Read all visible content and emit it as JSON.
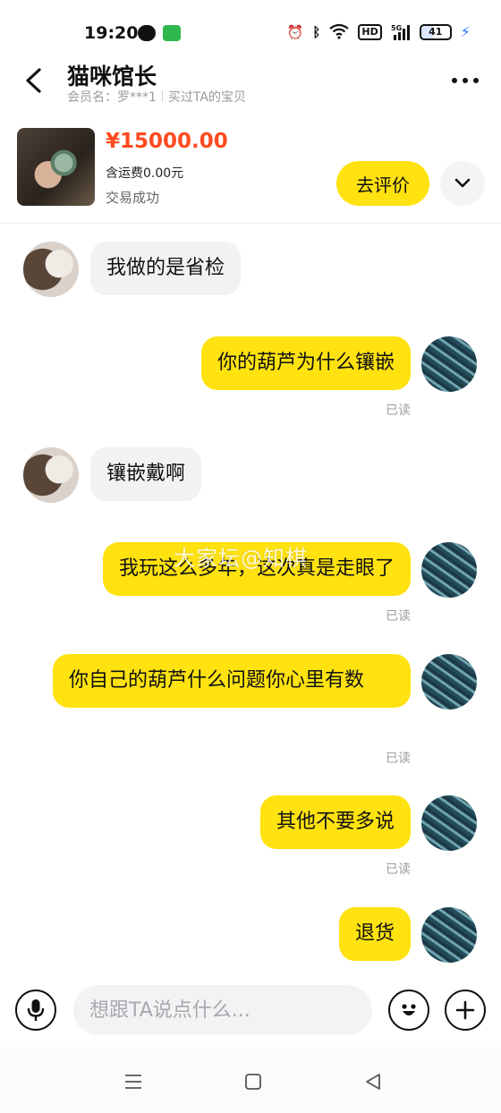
{
  "status_bar": {
    "time": "19:20",
    "icons": [
      "wechat-icon",
      "message-app-icon",
      "alarm-icon",
      "bluetooth-icon",
      "wifi-icon",
      "hd-icon",
      "signal-5g-icon",
      "battery-icon",
      "charging-icon"
    ],
    "hd_label": "HD",
    "network_label": "5G",
    "battery_level": "41"
  },
  "header": {
    "title": "猫咪馆长",
    "member": "会员名：罗***1",
    "bought": "买过TA的宝贝"
  },
  "product": {
    "price": "¥15000.00",
    "shipping": "含运费0.00元",
    "status": "交易成功",
    "review_label": "去评价"
  },
  "messages": [
    {
      "side": "left",
      "text": "我做的是省检"
    },
    {
      "side": "right",
      "text": "你的葫芦为什么镶嵌",
      "read": "已读"
    },
    {
      "side": "left",
      "text": "镶嵌戴啊"
    },
    {
      "side": "right",
      "text": "我玩这么多年，这次真是走眼了",
      "read": "已读"
    },
    {
      "side": "right",
      "text": "你自己的葫芦什么问题你心里有数",
      "read": "已读"
    },
    {
      "side": "right",
      "text": "其他不要多说",
      "read": "已读"
    },
    {
      "side": "right",
      "text": "退货"
    }
  ],
  "watermark": "大家坛@知棋",
  "input": {
    "placeholder": "想跟TA说点什么..."
  },
  "colors": {
    "accent_yellow": "#ffe20f",
    "price_red": "#ff4b1f",
    "bubble_gray": "#f2f2f4"
  }
}
